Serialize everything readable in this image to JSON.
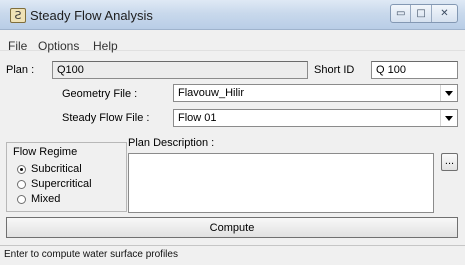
{
  "window": {
    "title": "Steady Flow Analysis",
    "icon_glyph": "Ƨ",
    "buttons": {
      "minimize": "▭",
      "maximize": "□",
      "close": "✕"
    }
  },
  "menu": {
    "items": [
      "File",
      "Options",
      "Help"
    ]
  },
  "plan": {
    "label": "Plan :",
    "value": "Q100",
    "short_id_label": "Short ID",
    "short_id_value": "Q 100"
  },
  "geometry": {
    "label": "Geometry File :",
    "value": "Flavouw_Hilir"
  },
  "steady_flow": {
    "label": "Steady Flow File :",
    "value": "Flow 01"
  },
  "flow_regime": {
    "legend": "Flow Regime",
    "options": [
      {
        "label": "Subcritical",
        "selected": true
      },
      {
        "label": "Supercritical",
        "selected": false
      },
      {
        "label": "Mixed",
        "selected": false
      }
    ]
  },
  "description": {
    "label": "Plan Description :",
    "value": "",
    "button_label": "..."
  },
  "compute": {
    "label": "Compute"
  },
  "status": {
    "text": "Enter to compute water surface profiles"
  }
}
